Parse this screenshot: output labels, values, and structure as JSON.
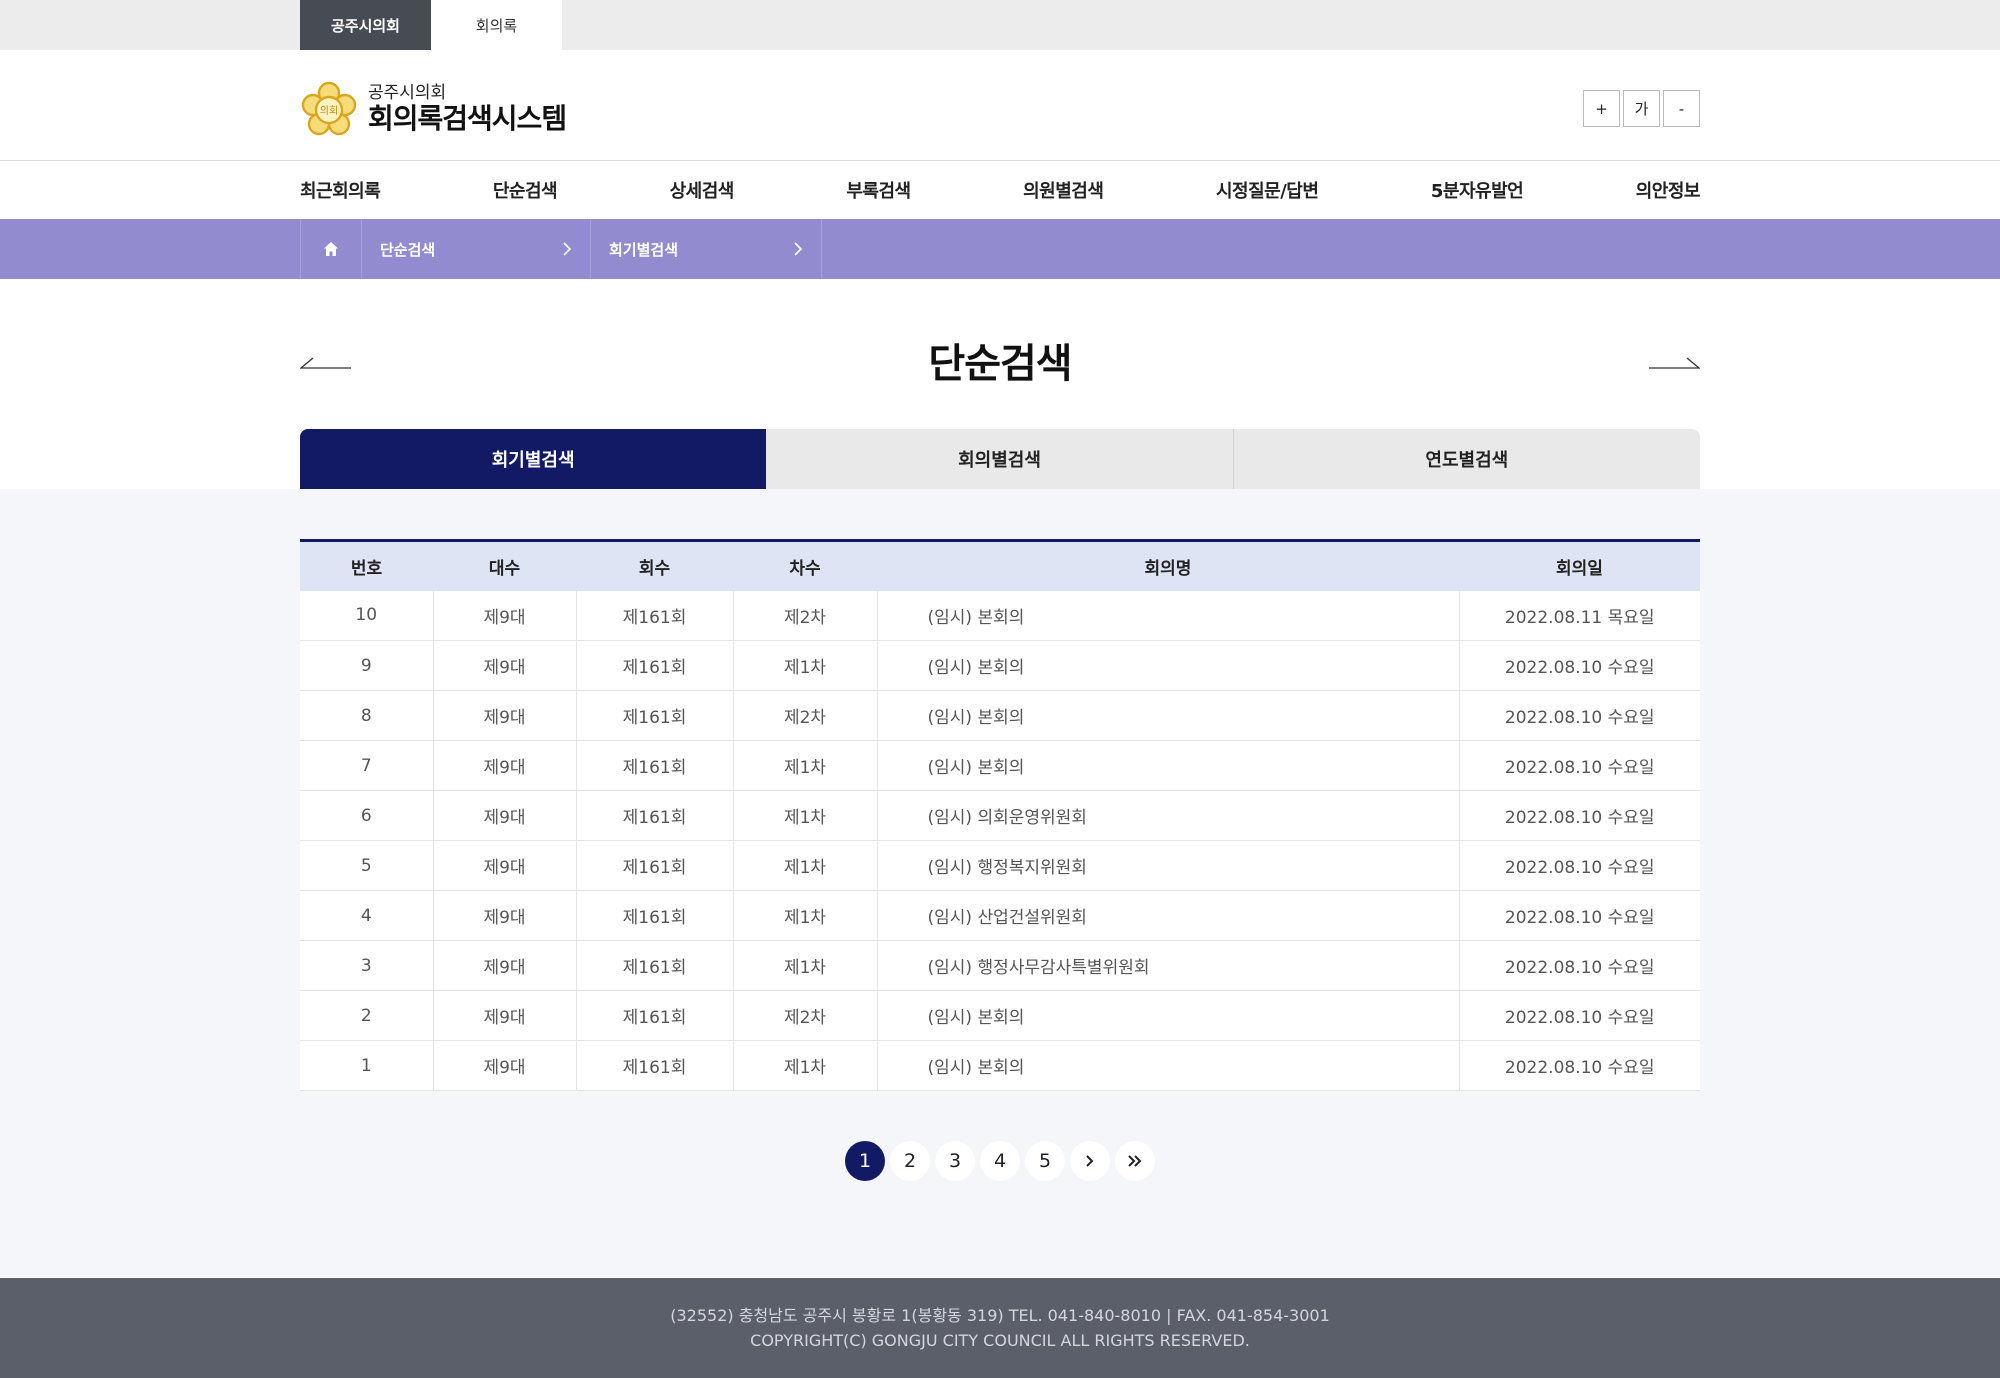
{
  "topbar": {
    "tabs": [
      "공주시의회",
      "회의록"
    ]
  },
  "header": {
    "logo_sub": "공주시의회",
    "logo_main": "회의록검색시스템",
    "font_controls": [
      "+",
      "가",
      "-"
    ]
  },
  "gnb": [
    "최근회의록",
    "단순검색",
    "상세검색",
    "부록검색",
    "의원별검색",
    "시정질문/답변",
    "5분자유발언",
    "의안정보"
  ],
  "breadcrumb": {
    "level1": "단순검색",
    "level2": "회기별검색"
  },
  "page_title": "단순검색",
  "tabs": [
    "회기별검색",
    "회의별검색",
    "연도별검색"
  ],
  "table": {
    "headers": [
      "번호",
      "대수",
      "회수",
      "차수",
      "회의명",
      "회의일"
    ],
    "rows": [
      [
        "10",
        "제9대",
        "제161회",
        "제2차",
        "(임시) 본회의",
        "2022.08.11 목요일"
      ],
      [
        "9",
        "제9대",
        "제161회",
        "제1차",
        "(임시) 본회의",
        "2022.08.10 수요일"
      ],
      [
        "8",
        "제9대",
        "제161회",
        "제2차",
        "(임시) 본회의",
        "2022.08.10 수요일"
      ],
      [
        "7",
        "제9대",
        "제161회",
        "제1차",
        "(임시) 본회의",
        "2022.08.10 수요일"
      ],
      [
        "6",
        "제9대",
        "제161회",
        "제1차",
        "(임시) 의회운영위원회",
        "2022.08.10 수요일"
      ],
      [
        "5",
        "제9대",
        "제161회",
        "제1차",
        "(임시) 행정복지위원회",
        "2022.08.10 수요일"
      ],
      [
        "4",
        "제9대",
        "제161회",
        "제1차",
        "(임시) 산업건설위원회",
        "2022.08.10 수요일"
      ],
      [
        "3",
        "제9대",
        "제161회",
        "제1차",
        "(임시) 행정사무감사특별위원회",
        "2022.08.10 수요일"
      ],
      [
        "2",
        "제9대",
        "제161회",
        "제2차",
        "(임시) 본회의",
        "2022.08.10 수요일"
      ],
      [
        "1",
        "제9대",
        "제161회",
        "제1차",
        "(임시) 본회의",
        "2022.08.10 수요일"
      ]
    ]
  },
  "pagination": {
    "pages": [
      "1",
      "2",
      "3",
      "4",
      "5"
    ],
    "current": "1",
    "next": "›",
    "last": "»"
  },
  "footer": {
    "line1": "(32552) 충청남도 공주시 봉황로 1(봉황동 319) TEL. 041-840-8010 | FAX. 041-854-3001",
    "line2": "COPYRIGHT(C) GONGJU CITY COUNCIL ALL RIGHTS RESERVED."
  },
  "colors": {
    "primary": "#121a66",
    "breadcrumb": "#938bcf",
    "footer": "#5a5f6a",
    "dark_tab": "#474b54"
  }
}
